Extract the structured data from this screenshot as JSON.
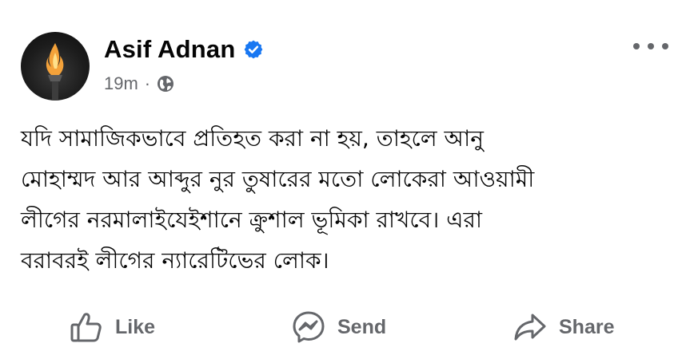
{
  "post": {
    "author": {
      "name": "Asif Adnan",
      "verified": true,
      "verified_color": "#1877f2"
    },
    "time": "19m",
    "separator": "·",
    "audience_icon": "globe-icon",
    "more_icon": "more-horizontal-icon",
    "text_lines": [
      "যদি সামাজিকভাবে প্রতিহত করা না হয়, তাহলে আনু",
      "মোহাম্মদ আর আব্দুর নুর তুষারের মতো লোকেরা আওয়ামী",
      "লীগের নরমালাইযেইশানে ক্রুশাল ভূমিকা রাখবে। এরা",
      "বরাবরই লীগের ন্যারেটিভের লোক।"
    ]
  },
  "actions": {
    "like": {
      "label": "Like",
      "icon": "thumbs-up-icon"
    },
    "send": {
      "label": "Send",
      "icon": "messenger-icon"
    },
    "share": {
      "label": "Share",
      "icon": "share-arrow-icon"
    }
  },
  "colors": {
    "text_primary": "#050505",
    "text_secondary": "#65676b",
    "background": "#ffffff"
  }
}
